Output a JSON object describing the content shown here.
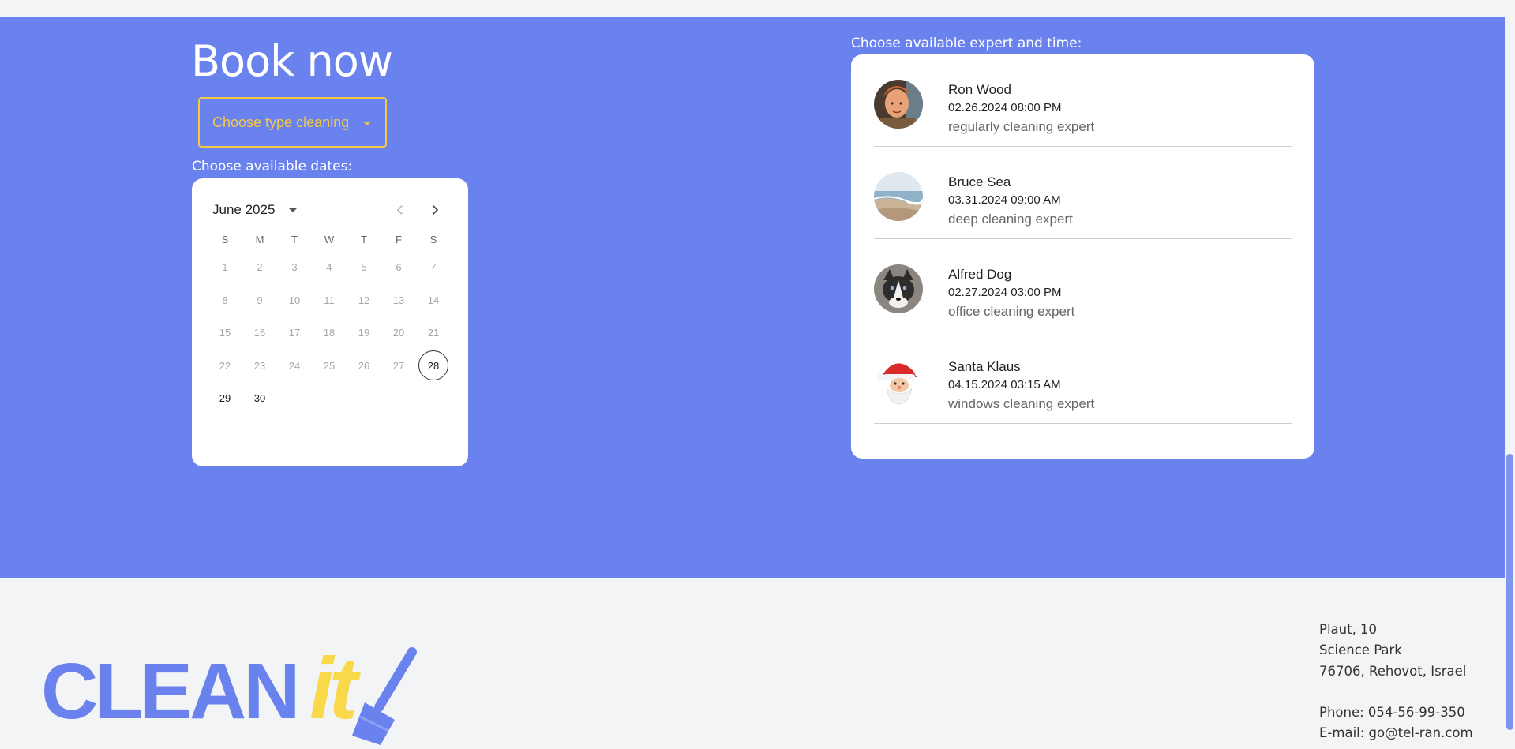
{
  "booking": {
    "title": "Book now",
    "select": {
      "placeholder": "Choose type cleaning"
    },
    "dates_label": "Choose available dates:",
    "experts_label": "Choose available expert and time:"
  },
  "calendar": {
    "month": "June 2025",
    "weekdays": [
      "S",
      "M",
      "T",
      "W",
      "T",
      "F",
      "S"
    ],
    "weeks": [
      [
        "1",
        "2",
        "3",
        "4",
        "5",
        "6",
        "7"
      ],
      [
        "8",
        "9",
        "10",
        "11",
        "12",
        "13",
        "14"
      ],
      [
        "15",
        "16",
        "17",
        "18",
        "19",
        "20",
        "21"
      ],
      [
        "22",
        "23",
        "24",
        "25",
        "26",
        "27",
        "28"
      ],
      [
        "29",
        "30",
        "",
        "",
        "",
        "",
        ""
      ]
    ],
    "today": "28",
    "enabled_days": [
      "28",
      "29",
      "30"
    ]
  },
  "experts": [
    {
      "name": "Ron Wood",
      "time": "02.26.2024 08:00 PM",
      "role": "regularly cleaning expert",
      "avatar": "person-avatar"
    },
    {
      "name": "Bruce Sea",
      "time": "03.31.2024 09:00 AM",
      "role": "deep cleaning expert",
      "avatar": "beach-avatar"
    },
    {
      "name": "Alfred Dog",
      "time": "02.27.2024 03:00 PM",
      "role": "office cleaning expert",
      "avatar": "dog-avatar"
    },
    {
      "name": "Santa Klaus",
      "time": "04.15.2024 03:15 AM",
      "role": "windows cleaning expert",
      "avatar": "santa-avatar"
    }
  ],
  "footer": {
    "logo": {
      "main": "CLEAN",
      "accent": "it"
    },
    "address": {
      "line1": "Plaut, 10",
      "line2": "Science Park",
      "line3": "76706, Rehovot, Israel",
      "phone": "Phone: 054-56-99-350",
      "email": "E-mail: go@tel-ran.com"
    }
  },
  "colors": {
    "booking_bg": "#6a82ee",
    "accent_yellow": "#f5c844",
    "page_bg": "#f3f4f6",
    "logo_blue": "#6a82ee",
    "logo_yellow": "#f9d84a"
  }
}
